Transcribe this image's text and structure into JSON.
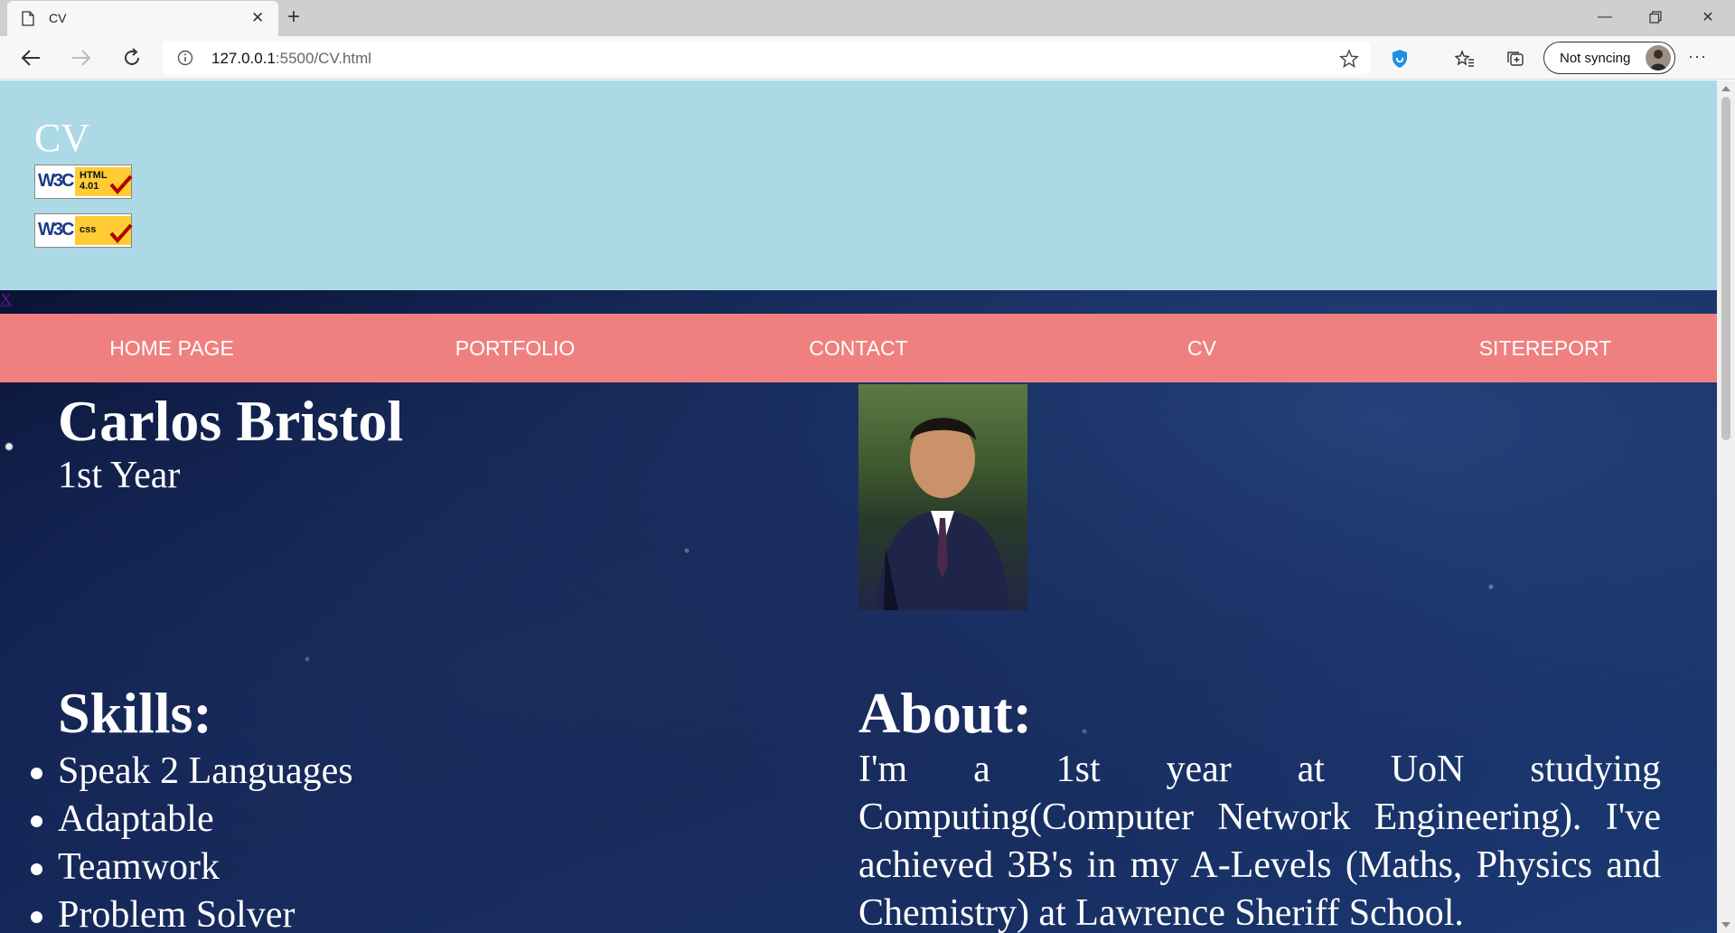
{
  "browser": {
    "tab_title": "CV",
    "url_host": "127.0.0.1",
    "url_rest": ":5500/CV.html",
    "sync_label": "Not syncing"
  },
  "header": {
    "title": "CV",
    "badges": [
      {
        "w3c": "W3C",
        "label_line1": "HTML",
        "label_line2": "4.01"
      },
      {
        "w3c": "W3C",
        "label_line1": "css",
        "label_line2": ""
      }
    ]
  },
  "close_link": "X",
  "nav": {
    "items": [
      "HOME PAGE",
      "PORTFOLIO",
      "CONTACT",
      "CV",
      "SITEREPORT"
    ]
  },
  "profile": {
    "name": "Carlos Bristol",
    "year": "1st Year"
  },
  "skills": {
    "heading": "Skills:",
    "items": [
      "Speak 2 Languages",
      "Adaptable",
      "Teamwork",
      "Problem Solver"
    ]
  },
  "about": {
    "heading": "About:",
    "text": "I'm a 1st year at UoN studying Computing(Computer Network Engineering). I've achieved 3B's in my A-Levels (Maths, Physics and Chemistry) at Lawrence Sheriff School."
  },
  "colors": {
    "header_bg": "#add8e6",
    "nav_bg": "#f08080",
    "text": "#ffffff"
  }
}
